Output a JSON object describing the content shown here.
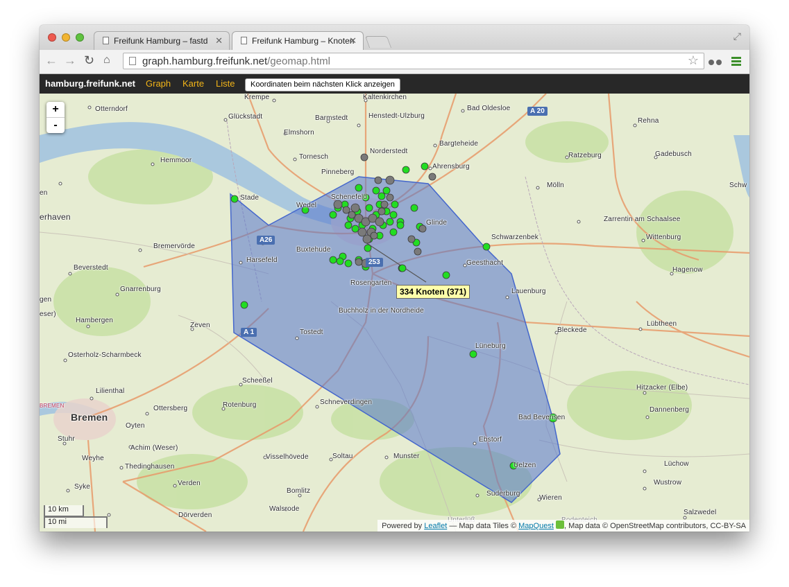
{
  "browser": {
    "tabs": [
      {
        "title": "Freifunk Hamburg – fastd",
        "active": false
      },
      {
        "title": "Freifunk Hamburg – Knoten",
        "active": true
      }
    ],
    "url_host": "graph.hamburg.freifunk.net",
    "url_path": "/geomap.html"
  },
  "site_nav": {
    "brand": "hamburg.freifunk.net",
    "links": [
      "Graph",
      "Karte",
      "Liste"
    ],
    "coord_button": "Koordinaten beim nächsten Klick anzeigen",
    "link_color": "#f2b418"
  },
  "map": {
    "zoom_in": "+",
    "zoom_out": "-",
    "scale_km": "10 km",
    "scale_mi": "10 mi",
    "cluster_tooltip": "334 Knoten (371)",
    "cluster_fill": "#5577cc",
    "node_online_color": "#22dd22",
    "node_offline_color": "#777777",
    "attribution": {
      "prefix": "Powered by",
      "leaflet": "Leaflet",
      "tiles": "— Map data Tiles ©",
      "mapquest": "MapQuest",
      "osm": ", Map data © OpenStreetMap contributors, CC-BY-SA"
    },
    "places": {
      "krempe": "Krempe",
      "kaltenkirchen": "Kaltenkirchen",
      "otterndorf": "Otterndorf",
      "glueckstadt": "Glückstadt",
      "barmstedt": "Barmstedt",
      "henstedt": "Henstedt-Ulzburg",
      "oldesloe": "Bad Oldesloe",
      "rehna": "Rehna",
      "elmshorn": "Elmshorn",
      "norderstedt": "Norderstedt",
      "bargteheide": "Bargteheide",
      "tornesch": "Tornesch",
      "hemmoor": "Hemmoor",
      "pinneberg": "Pinneberg",
      "ahrensburg": "Ahrensburg",
      "ratzeburg": "Ratzeburg",
      "gadebusch": "Gadebusch",
      "schenefeld": "Schenefeld",
      "moelln": "Mölln",
      "stade": "Stade",
      "wedel": "Wedel",
      "glinde": "Glinde",
      "zarrentin": "Zarrentin am Schaalsee",
      "schwerin_part": "Schw",
      "en_part": "en",
      "cuxhaven_part": "erhaven",
      "schwarzenbek": "Schwarzenbek",
      "wittenburg": "Wittenburg",
      "bremervoerde": "Bremervörde",
      "buxtehude": "Buxtehude",
      "harsefeld": "Harsefeld",
      "geesthacht": "Geesthacht",
      "beverstedt": "Beverstedt",
      "hagenow": "Hagenow",
      "rosengarten": "Rosengarten",
      "lauenburg": "Lauenburg",
      "gnarrenburg": "Gnarrenburg",
      "gen_part": "gen",
      "buchholz": "Buchholz in der Nordheide",
      "hambergen": "Hambergen",
      "zeven": "Zeven",
      "luebtheen": "Lübtheen",
      "weser_part": "eser)",
      "tostedt": "Tostedt",
      "bleckede": "Bleckede",
      "lueneburg": "Lüneburg",
      "osterholz": "Osterholz-Scharmbeck",
      "scheessel": "Scheeßel",
      "hitzacker": "Hitzacker (Elbe)",
      "lilienthal": "Lilienthal",
      "schneverdingen": "Schneverdingen",
      "ottersberg": "Ottersberg",
      "rotenburg": "Rotenburg",
      "dannenberg": "Dannenberg",
      "bremen_small": "BREMEN",
      "bremen": "Bremen",
      "oyten": "Oyten",
      "bevensen": "Bad Bevensen",
      "ebstorf": "Ebstorf",
      "stuhr": "Stuhr",
      "achim": "Achim (Weser)",
      "munster": "Munster",
      "weyhe": "Weyhe",
      "visselhoevede": "Visselhövede",
      "soltau": "Soltau",
      "uelzen": "Uelzen",
      "luechow": "Lüchow",
      "thedinghausen": "Thedinghausen",
      "syke": "Syke",
      "verden": "Verden",
      "bomlitz": "Bomlitz",
      "suderburg": "Suderburg",
      "wustrow": "Wustrow",
      "wieren": "Wieren",
      "walsrode": "Walsrode",
      "doerverden": "Dörverden",
      "salzwedel": "Salzwedel",
      "unterluess": "Unterlüß",
      "bodenteich": "Bodenteich"
    },
    "shields": {
      "a20": "A 20",
      "a26": "A26",
      "a1": "A 1",
      "a253": "253"
    }
  }
}
